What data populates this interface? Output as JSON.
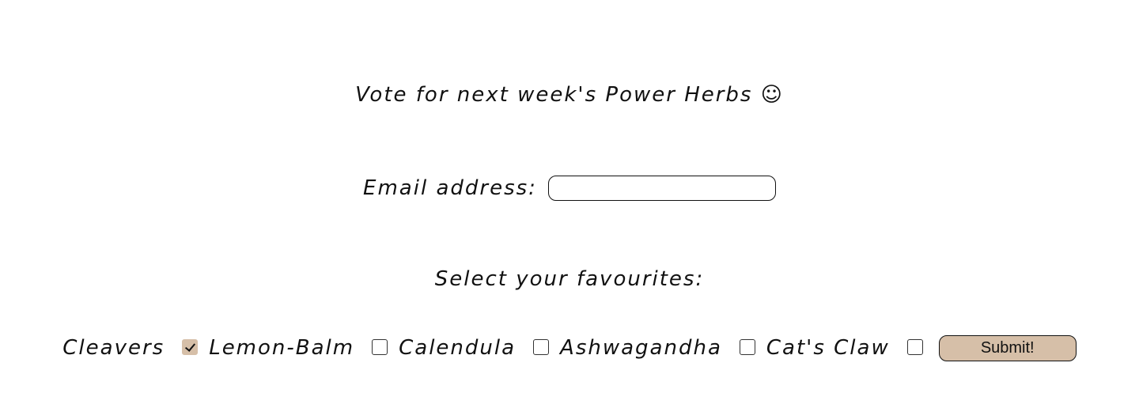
{
  "heading": {
    "text": "Vote for next week's Power Herbs ☺"
  },
  "email": {
    "label": "Email address:",
    "value": "",
    "placeholder": ""
  },
  "favourites": {
    "label": "Select your favourites:",
    "options": [
      {
        "label": "Cleavers",
        "checked": true
      },
      {
        "label": "Lemon-Balm",
        "checked": false
      },
      {
        "label": "Calendula",
        "checked": false
      },
      {
        "label": "Ashwagandha",
        "checked": false
      },
      {
        "label": "Cat's Claw",
        "checked": false
      }
    ]
  },
  "submit": {
    "label": "Submit!"
  },
  "colors": {
    "accent": "#d6bfa8",
    "text": "#111111",
    "background": "#ffffff"
  }
}
